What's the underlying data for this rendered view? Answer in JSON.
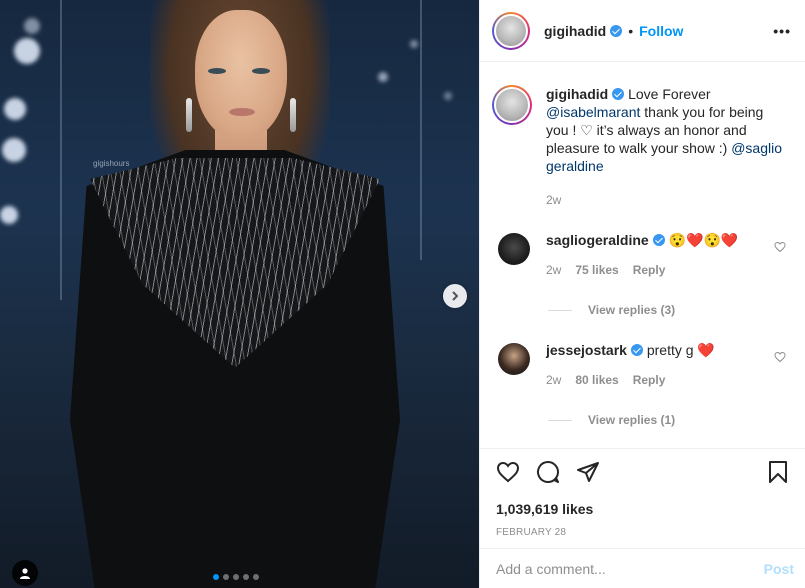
{
  "media": {
    "watermark": "gigishours",
    "carousel_dots": [
      true,
      false,
      false,
      false,
      false
    ]
  },
  "header": {
    "username": "gigihadid",
    "bullet": "•",
    "follow_label": "Follow",
    "more_label": "•••"
  },
  "caption": {
    "username": "gigihadid",
    "text_1": " Love Forever ",
    "mention_1": "@isabelmarant",
    "text_2": " thank you for being you ! ♡ it’s always an honor and pleasure to walk your show :) ",
    "mention_2": "@saglio​geraldine",
    "time": "2w"
  },
  "comments": [
    {
      "username": "saglio​geraldine",
      "text": " 😯❤️😯❤️",
      "time": "2w",
      "likes": "75 likes",
      "reply_label": "Reply",
      "view_replies": "View replies (3)"
    },
    {
      "username": "jessejostark",
      "text": " pretty g ❤️",
      "time": "2w",
      "likes": "80 likes",
      "reply_label": "Reply",
      "view_replies": "View replies (1)"
    }
  ],
  "actions": {
    "likes_count": "1,039,619 likes",
    "date": "FEBRUARY 28"
  },
  "add_comment": {
    "placeholder": "Add a comment...",
    "post_label": "Post"
  },
  "colors": {
    "accent": "#0095f6",
    "verified": "#3897f0",
    "text": "#262626",
    "muted": "#8e8e8e"
  }
}
